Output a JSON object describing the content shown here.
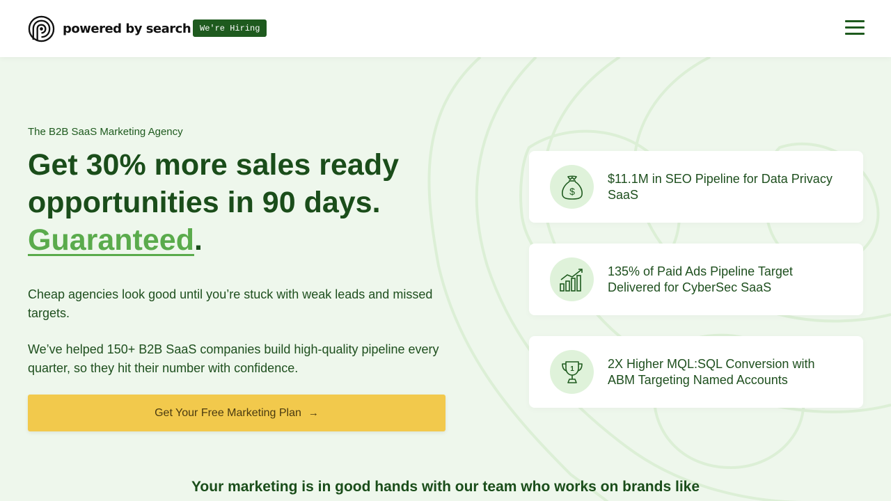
{
  "header": {
    "logo_text": "powered by search",
    "hiring_badge": "We're Hiring",
    "menu_icon": "hamburger-menu-icon"
  },
  "hero": {
    "eyebrow": "The B2B SaaS Marketing Agency",
    "headline_line1": "Get 30% more sales ready",
    "headline_line2": "opportunities in 90 days.",
    "headline_guaranteed": "Guaranteed",
    "headline_period": ".",
    "paragraph1": "Cheap agencies look good until you’re stuck with weak leads and missed targets.",
    "paragraph2": "We’ve helped 150+ B2B SaaS companies build high-quality pipeline every quarter, so they hit their number with confidence.",
    "cta_label": "Get Your Free Marketing Plan",
    "cta_arrow": "→"
  },
  "stats": [
    {
      "icon": "money-bag-icon",
      "text": "$11.1M in SEO Pipeline for Data Privacy SaaS"
    },
    {
      "icon": "growth-chart-icon",
      "text": "135% of Paid Ads Pipeline Target Delivered for CyberSec SaaS"
    },
    {
      "icon": "trophy-icon",
      "text": "2X Higher MQL:SQL Conversion with ABM Targeting Named Accounts"
    }
  ],
  "brands": {
    "title": "Your marketing is in good hands with our team who works on brands like"
  },
  "colors": {
    "brand_dark_green": "#1a4d1a",
    "accent_green": "#5aab4c",
    "cta_yellow": "#f2c94c",
    "page_bg": "#eef7ec"
  }
}
